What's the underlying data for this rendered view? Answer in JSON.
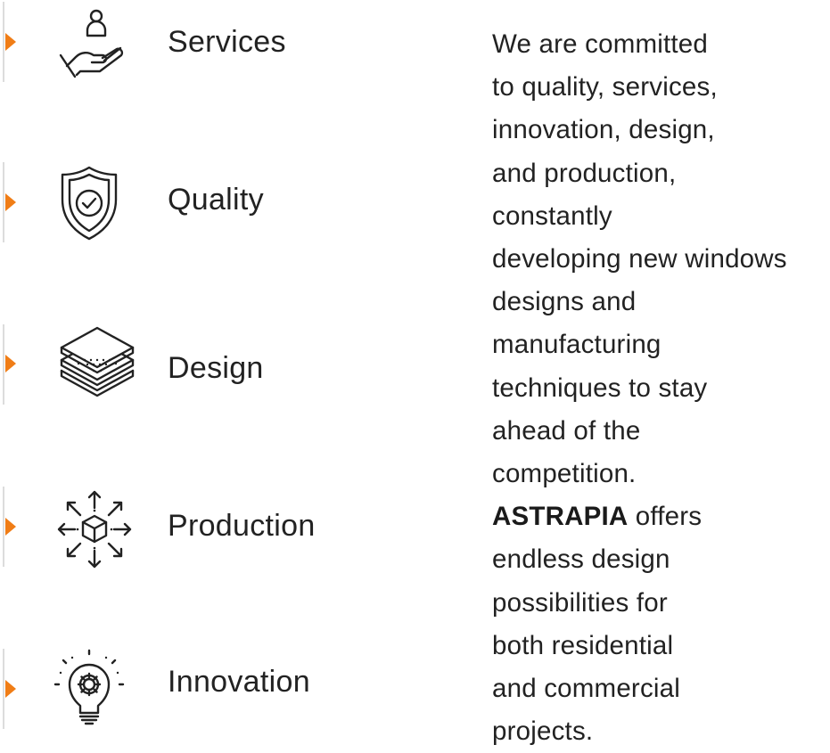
{
  "accent_color": "#f07d16",
  "features": [
    {
      "label": "Services",
      "icon": "hand-person-icon"
    },
    {
      "label": "Quality",
      "icon": "shield-check-icon"
    },
    {
      "label": "Design",
      "icon": "layers-icon"
    },
    {
      "label": "Production",
      "icon": "cube-arrows-icon"
    },
    {
      "label": "Innovation",
      "icon": "lightbulb-gear-icon"
    }
  ],
  "description": {
    "lines_before_brand": [
      "We are committed",
      "to quality, services,",
      "innovation, design,",
      "and production,",
      "constantly",
      "developing new windows",
      "designs and",
      "manufacturing",
      "techniques to stay",
      "ahead of the",
      "competition."
    ],
    "brand": "ASTRAPIA",
    "brand_suffix": " offers",
    "lines_after_brand": [
      "endless design",
      "possibilities for",
      "both residential",
      "and commercial",
      "projects."
    ]
  }
}
